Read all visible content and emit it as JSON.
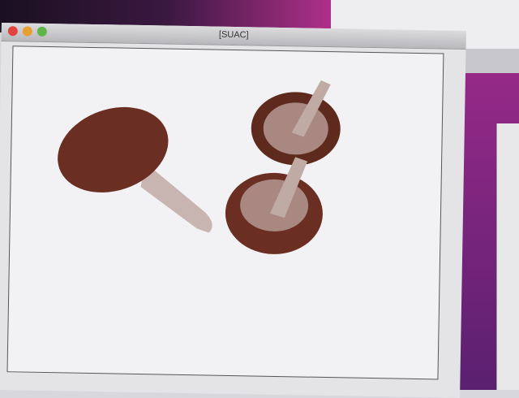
{
  "window": {
    "title": "[SUAC]"
  },
  "colors": {
    "close": "#e0443e",
    "minimize": "#e9a030",
    "zoom": "#5fb548",
    "mushroom": "#6a2e22"
  }
}
